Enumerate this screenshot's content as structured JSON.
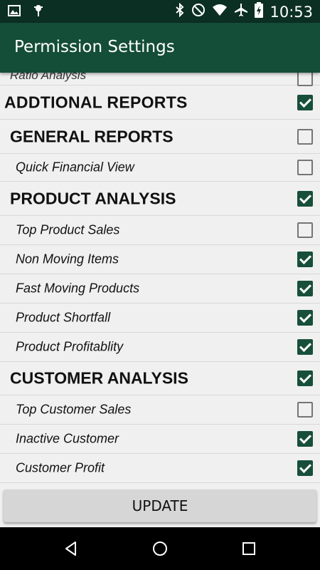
{
  "status_bar": {
    "time": "10:53",
    "left_icons": [
      "image-icon",
      "android-debug-icon"
    ],
    "right_icons": [
      "bluetooth-icon",
      "do-not-disturb-icon",
      "wifi-icon",
      "airplane-icon",
      "battery-charging-icon"
    ]
  },
  "app_bar": {
    "title": "Permission Settings"
  },
  "list": {
    "partial_item": {
      "label": "Ratio Analysis",
      "checked": false
    },
    "additional_reports": {
      "label": "ADDTIONAL REPORTS",
      "checked": true
    },
    "general_reports": {
      "label": "GENERAL REPORTS",
      "checked": false
    },
    "quick_financial_view": {
      "label": "Quick Financial View",
      "checked": false
    },
    "product_analysis": {
      "label": "PRODUCT ANALYSIS",
      "checked": true
    },
    "top_product_sales": {
      "label": "Top Product Sales",
      "checked": false
    },
    "non_moving_items": {
      "label": "Non Moving Items",
      "checked": true
    },
    "fast_moving_products": {
      "label": "Fast Moving Products",
      "checked": true
    },
    "product_shortfall": {
      "label": "Product Shortfall",
      "checked": true
    },
    "product_profitability": {
      "label": "Product Profitablity",
      "checked": true
    },
    "customer_analysis": {
      "label": "CUSTOMER ANALYSIS",
      "checked": true
    },
    "top_customer_sales": {
      "label": "Top Customer Sales",
      "checked": false
    },
    "inactive_customer": {
      "label": "Inactive Customer",
      "checked": true
    },
    "customer_profit": {
      "label": "Customer Profit",
      "checked": true
    }
  },
  "actions": {
    "update_label": "UPDATE"
  },
  "nav_bar": {
    "buttons": [
      "back-icon",
      "home-icon",
      "recents-icon"
    ]
  },
  "colors": {
    "status_bar": "#0b2f23",
    "app_bar": "#144d38",
    "checkbox_checked": "#174f3a"
  }
}
